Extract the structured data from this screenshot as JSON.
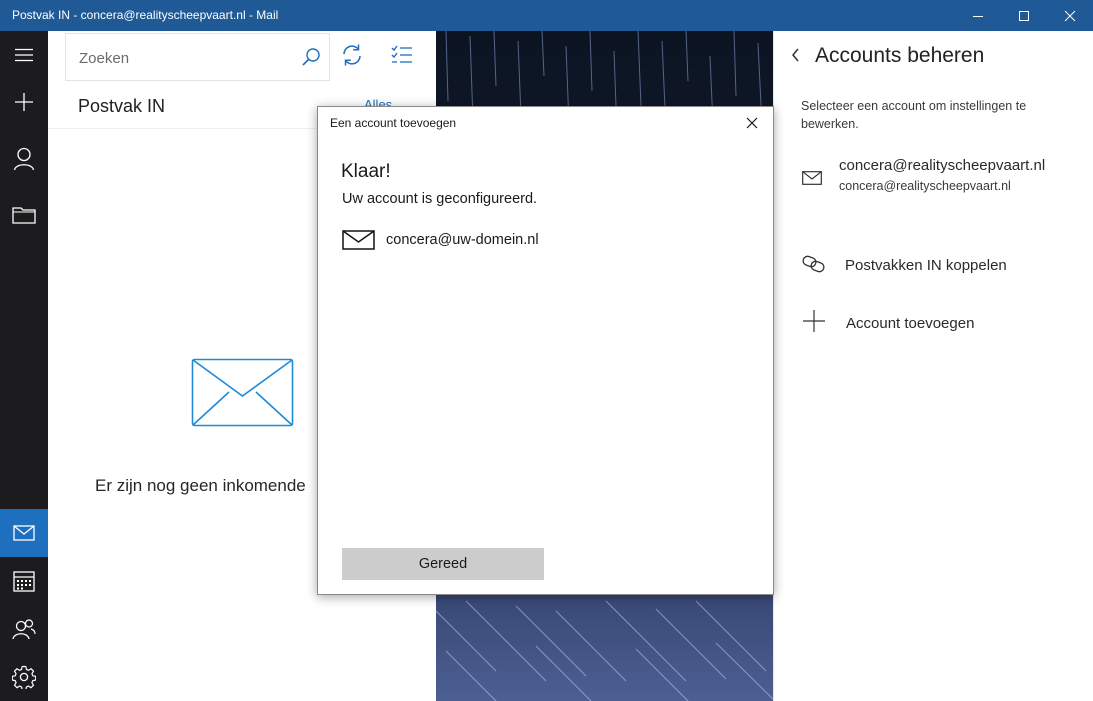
{
  "window": {
    "title": "Postvak IN - concera@realityscheepvaart.nl - Mail"
  },
  "rail": {
    "items": [
      {
        "name": "hamburger-menu",
        "icon": "hamburger-icon"
      },
      {
        "name": "new-mail",
        "icon": "plus-icon"
      },
      {
        "name": "accounts",
        "icon": "person-icon"
      },
      {
        "name": "folders",
        "icon": "folder-icon"
      },
      {
        "name": "mail",
        "icon": "mail-icon",
        "active": true
      },
      {
        "name": "calendar",
        "icon": "calendar-icon"
      },
      {
        "name": "people",
        "icon": "people-icon"
      },
      {
        "name": "settings",
        "icon": "gear-icon"
      }
    ],
    "accent": "#1f6fbf"
  },
  "list": {
    "search_placeholder": "Zoeken",
    "folder_title": "Postvak IN",
    "filter_label": "Alles",
    "empty_message": "Er zijn nog geen inkomende"
  },
  "accounts_pane": {
    "heading": "Accounts beheren",
    "hint": "Selecteer een account om instellingen te bewerken.",
    "account": {
      "display": "concera@realityscheepvaart.nl",
      "email": "concera@realityscheepvaart.nl"
    },
    "link_inboxes_label": "Postvakken IN koppelen",
    "add_account_label": "Account toevoegen"
  },
  "dialog": {
    "title": "Een account toevoegen",
    "heading": "Klaar!",
    "message": "Uw account is geconfigureerd.",
    "account_address": "concera@uw-domein.nl",
    "done_button": "Gereed"
  },
  "colors": {
    "titlebar": "#1f5a97",
    "rail": "#1c1c1f",
    "accent": "#1f6fbf"
  }
}
